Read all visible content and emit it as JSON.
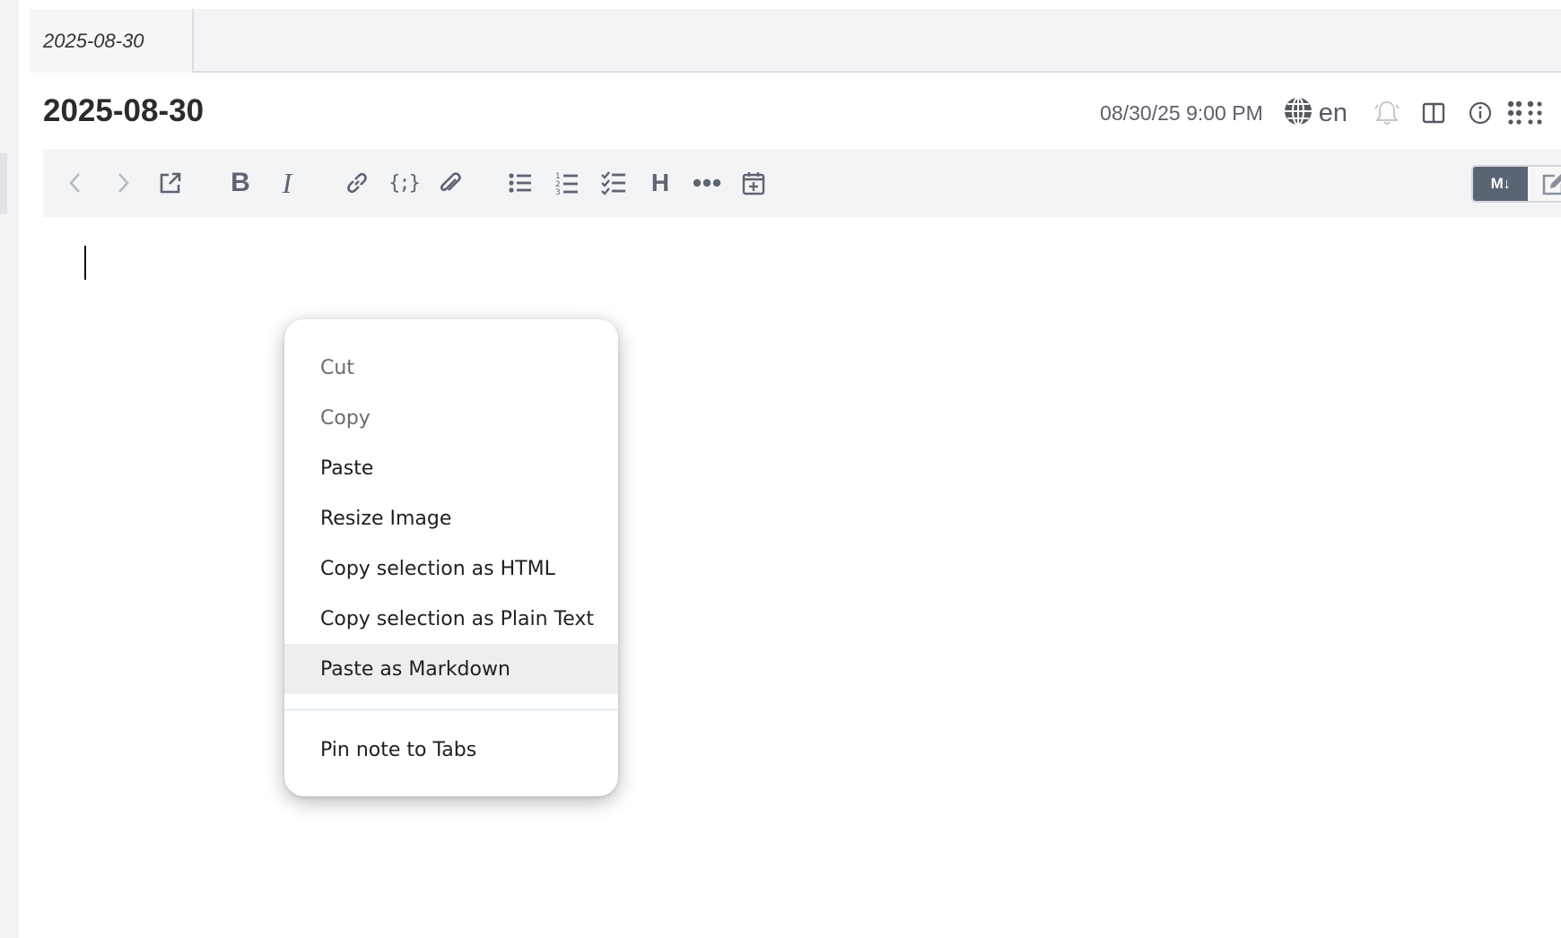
{
  "tabs": [
    {
      "label": "2025-08-30"
    }
  ],
  "note": {
    "title": "2025-08-30"
  },
  "header": {
    "date": "08/30/25 9:00 PM",
    "language": "en",
    "icons": [
      "globe-icon",
      "bell-icon",
      "split-view-icon",
      "info-icon",
      "apps-grid-icon"
    ]
  },
  "toolbar": {
    "buttons": [
      "back",
      "forward",
      "open-external",
      "bold",
      "italic",
      "link",
      "code",
      "attachment",
      "bullet-list",
      "numbered-list",
      "task-list",
      "heading",
      "more",
      "insert-date"
    ],
    "mode_md_label": "M↓"
  },
  "context_menu": {
    "items": [
      {
        "label": "Cut",
        "disabled": true
      },
      {
        "label": "Copy",
        "disabled": true
      },
      {
        "label": "Paste",
        "disabled": false
      },
      {
        "label": "Resize Image",
        "disabled": false
      },
      {
        "label": "Copy selection as HTML",
        "disabled": false
      },
      {
        "label": "Copy selection as Plain Text",
        "disabled": false
      },
      {
        "label": "Paste as Markdown",
        "disabled": false,
        "highlighted": true
      },
      {
        "label": "Pin note to Tabs",
        "disabled": false
      }
    ]
  },
  "colors": {
    "toolbar_bg": "#f3f4f6",
    "icon": "#5d6573",
    "md_toggle": "#5b6473",
    "hover": "#eeeeef"
  }
}
